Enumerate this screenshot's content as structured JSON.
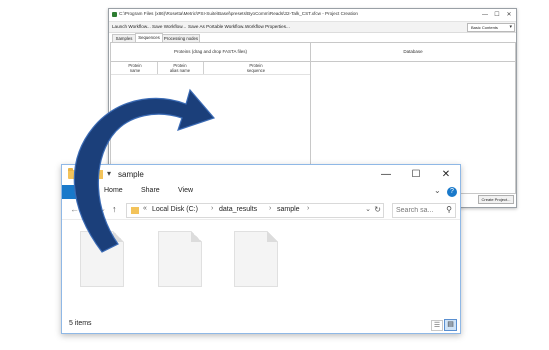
{
  "project_window": {
    "title": "C:\\Program Files (x86)\\Rosetta\\Metric\\PSI-Suite\\Basel\\presets\\ByoComm\\Reads\\32-Talk_CST.xfcw - Project Creation",
    "controls": {
      "minimize": "—",
      "maximize": "☐",
      "close": "✕"
    },
    "toolbar": {
      "launch": "Launch Workflow...",
      "save": "Save Workflow...",
      "save_portable": "Save As Portable Workflow...",
      "properties": "Workflow Properties..."
    },
    "mode_select": "Basic Contents",
    "tabs": [
      "Samples",
      "Sequences",
      "Processing nodes"
    ],
    "active_tab": "Sequences",
    "proteins_header": "Proteins (drag and drop FASTA files)",
    "database_header": "Database",
    "columns": {
      "name": "Protein\nname",
      "alias": "Protein\nalias name",
      "sequence": "Protein\nsequence"
    },
    "create_button": "Create Project..."
  },
  "explorer": {
    "title": "sample",
    "controls": {
      "minimize": "—",
      "maximize": "☐",
      "close": "✕"
    },
    "ribbon": {
      "file": "File",
      "tabs": [
        "Home",
        "Share",
        "View"
      ]
    },
    "nav": {
      "back": "←",
      "forward": "→",
      "recent": "⌄",
      "up": "↑"
    },
    "address": {
      "prefix": "«",
      "crumbs": [
        "Local Disk (C:)",
        "data_results",
        "sample"
      ]
    },
    "search_placeholder": "Search sa...",
    "files_count": 5,
    "status": "5 items"
  },
  "colors": {
    "arrow": "#1b3f7a",
    "explorer_accent": "#1979ca",
    "folder": "#f3c35a"
  },
  "icons": {
    "search": "search-icon",
    "refresh": "refresh-icon",
    "help": "help-icon",
    "folder": "folder-icon",
    "file": "file-icon"
  }
}
